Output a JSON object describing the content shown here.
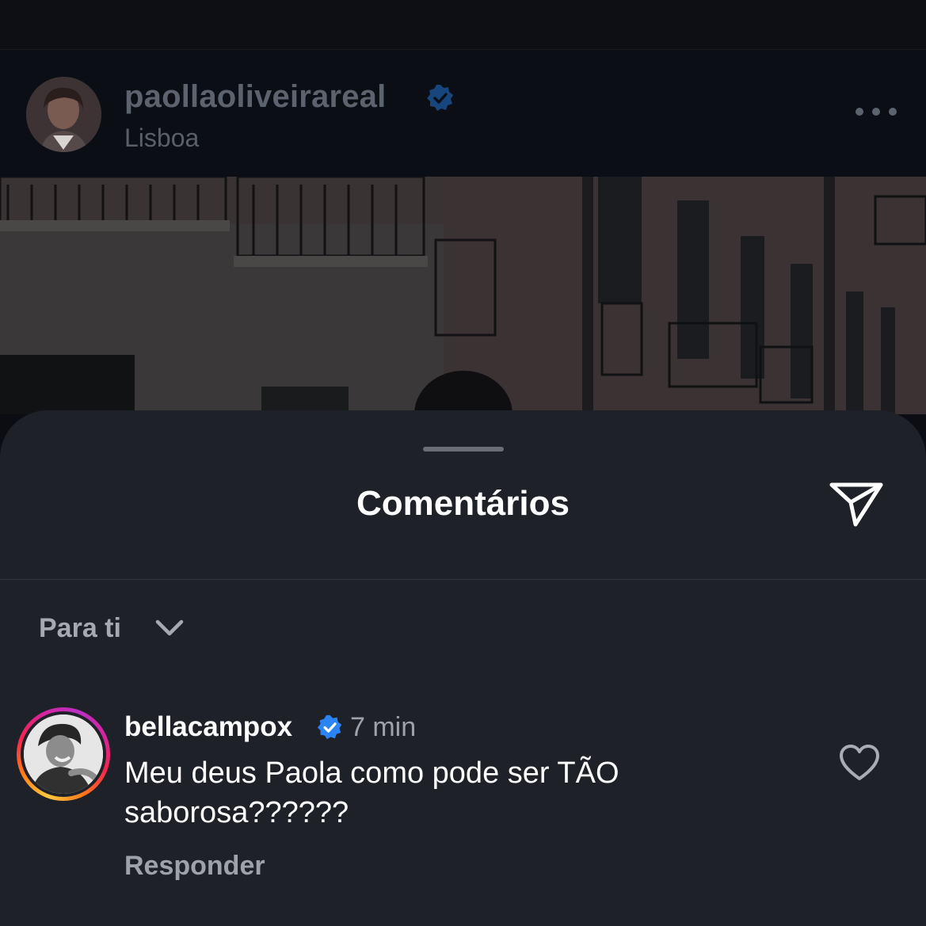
{
  "post": {
    "username": "paollaoliveirareal",
    "verified": true,
    "location": "Lisboa",
    "more_icon": "more-horizontal-icon"
  },
  "comments_sheet": {
    "title": "Comentários",
    "share_icon": "paper-plane-icon",
    "sort": {
      "label": "Para ti",
      "icon": "chevron-down-icon"
    },
    "comments": [
      {
        "username": "bellacampox",
        "verified": true,
        "time": "7 min",
        "text": "Meu deus Paola como pode ser TÃO saborosa??????",
        "reply_label": "Responder",
        "like_icon": "heart-outline-icon"
      }
    ]
  },
  "colors": {
    "verified_badge": "#2b84f5",
    "sheet_background": "#1f2128",
    "header_background": "#0b0e15",
    "story_ring_start": "#ffc83d",
    "story_ring_end": "#d6249f"
  }
}
